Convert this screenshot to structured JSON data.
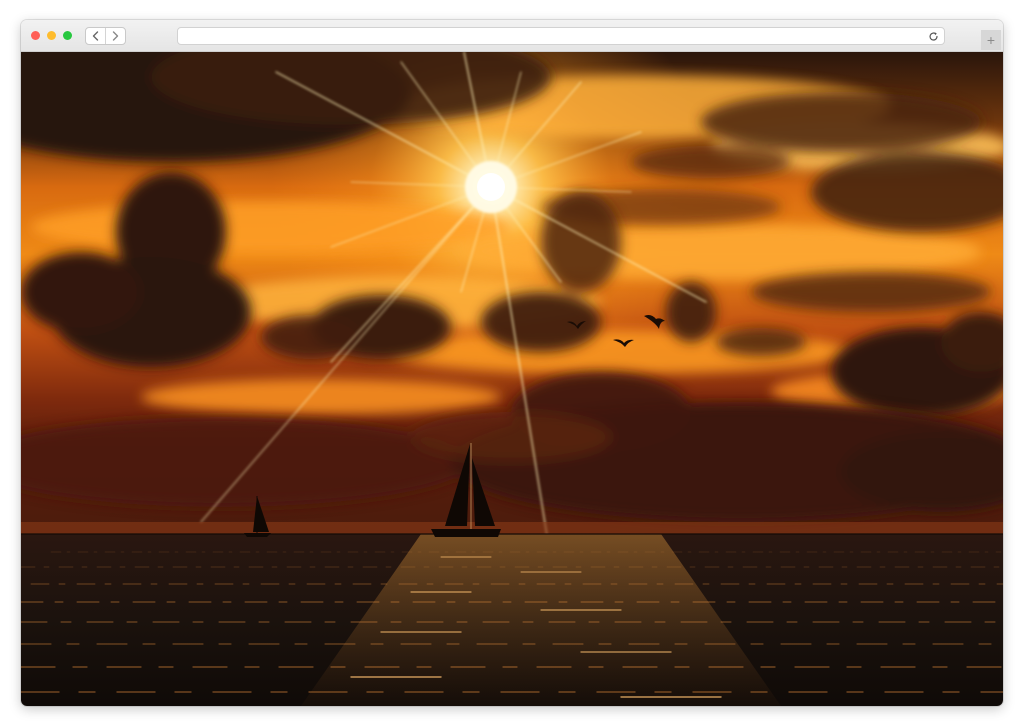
{
  "browser": {
    "address_bar": {
      "url": ""
    },
    "buttons": {
      "close": "close",
      "minimize": "minimize",
      "zoom": "zoom",
      "back": "back",
      "forward": "forward",
      "reload": "reload",
      "new_tab": "+"
    },
    "icons": {
      "back": "chevron-left-icon",
      "forward": "chevron-right-icon",
      "reload": "reload-icon",
      "new_tab": "plus-icon"
    },
    "colors": {
      "close": "#ff5f57",
      "minimize": "#febc2e",
      "zoom": "#28c840"
    }
  },
  "photo": {
    "subject": "sunset",
    "colors": {
      "sky_top": "#2a140a",
      "sun_glow": "#fff6c8",
      "cloud_orange": "#f08a1a",
      "cloud_dark": "#3a1e10",
      "sea": "#1b120d"
    }
  }
}
